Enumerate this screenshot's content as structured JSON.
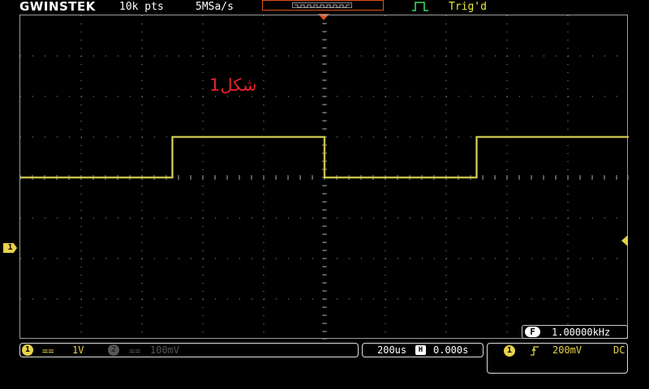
{
  "header": {
    "brand": "GWINSTEK",
    "record_length": "10k pts",
    "sample_rate": "5MSa/s",
    "trigger_status": "Trig'd"
  },
  "screen": {
    "annotation": "شکل1",
    "channel_marker": "1"
  },
  "trace": {
    "color": "#c9c23a",
    "frequency_khz": 1.0,
    "high_level_div": 1.0,
    "low_level_div": 0.0,
    "time_per_div_us": 200,
    "h_divisions": 10,
    "v_divisions": 8,
    "first_rising_edge_div": -2.5
  },
  "measurement": {
    "label": "F",
    "value": "1.00000kHz"
  },
  "channels": {
    "ch1": {
      "number": "1",
      "coupling": "==",
      "scale": "1V",
      "color": "#e8d24a"
    },
    "ch2": {
      "number": "2",
      "coupling": "==",
      "scale": "100mV",
      "color": "#555555"
    }
  },
  "timebase": {
    "scale": "200us",
    "icon": "H",
    "position": "0.000s"
  },
  "trigger": {
    "source": "1",
    "slope": "rising-edge-icon",
    "level": "200mV",
    "coupling": "DC"
  }
}
